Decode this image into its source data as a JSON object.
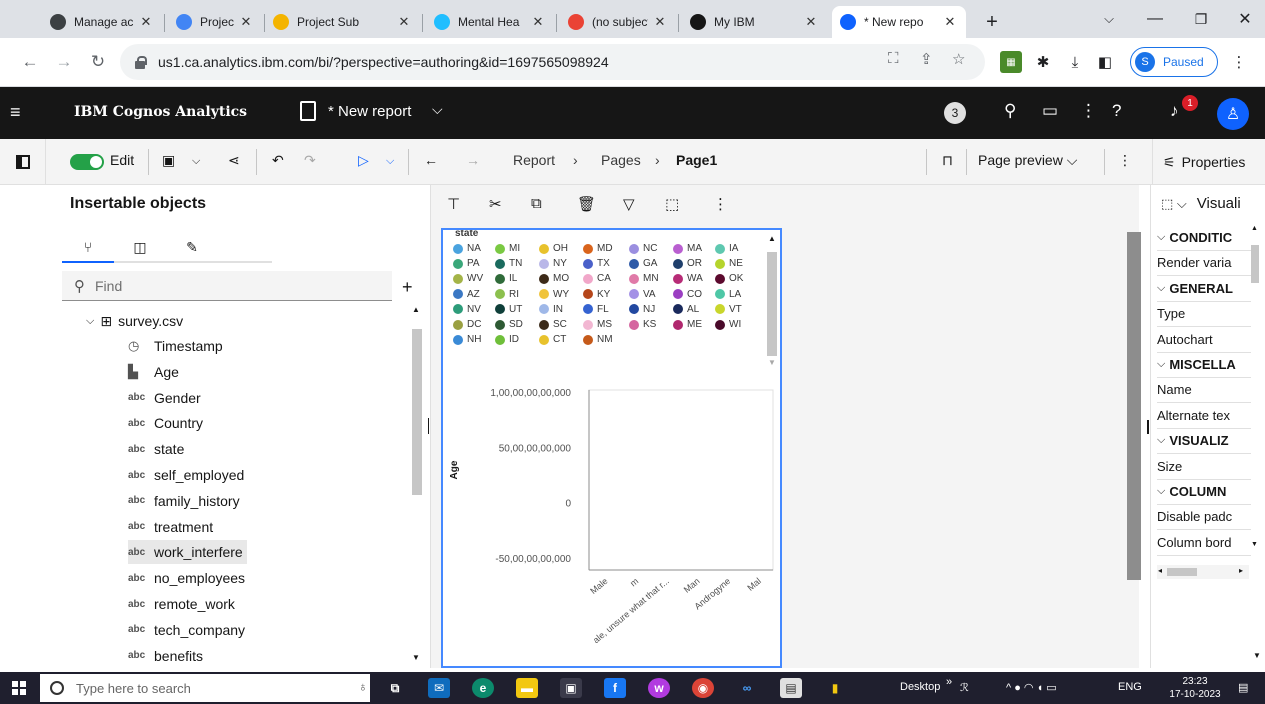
{
  "browser": {
    "tabs": [
      {
        "title": "Manage ac",
        "color": "#3c4043"
      },
      {
        "title": "Project Sub",
        "color": "#4285f4"
      },
      {
        "title": "Project Sub",
        "color": "#f4b400"
      },
      {
        "title": "Mental Hea",
        "color": "#20beff"
      },
      {
        "title": "(no subject",
        "color": "#ea4335"
      },
      {
        "title": "My IBM",
        "color": "#161616"
      },
      {
        "title": "* New repo",
        "color": "#0f62fe"
      }
    ],
    "close_glyph": "✕",
    "url": "us1.ca.analytics.ibm.com/bi/?perspective=authoring&id=1697565098924",
    "profile_initial": "S",
    "profile_status": "Paused"
  },
  "app": {
    "brand": "IBM Cognos Analytics",
    "report_title": "* New report",
    "notification_count": "3",
    "alert_count": "1"
  },
  "toolbar": {
    "edit_label": "Edit",
    "breadcrumbs": [
      "Report",
      "Pages",
      "Page1"
    ],
    "page_preview": "Page preview",
    "properties": "Properties"
  },
  "left_panel": {
    "title": "Insertable objects",
    "find_placeholder": "Find",
    "source": "survey.csv",
    "fields": [
      {
        "type": "◷",
        "name": "Timestamp"
      },
      {
        "type": "▙",
        "name": "Age"
      },
      {
        "type": "abc",
        "name": "Gender"
      },
      {
        "type": "abc",
        "name": "Country"
      },
      {
        "type": "abc",
        "name": "state"
      },
      {
        "type": "abc",
        "name": "self_employed"
      },
      {
        "type": "abc",
        "name": "family_history"
      },
      {
        "type": "abc",
        "name": "treatment"
      },
      {
        "type": "abc",
        "name": "work_interfere"
      },
      {
        "type": "abc",
        "name": "no_employees"
      },
      {
        "type": "abc",
        "name": "remote_work"
      },
      {
        "type": "abc",
        "name": "tech_company"
      },
      {
        "type": "abc",
        "name": "benefits"
      }
    ]
  },
  "chart_data": {
    "type": "bar",
    "legend_title": "state",
    "legend": [
      {
        "name": "NA",
        "color": "#4aa3df"
      },
      {
        "name": "MI",
        "color": "#7ac943"
      },
      {
        "name": "OH",
        "color": "#e8c22c"
      },
      {
        "name": "MD",
        "color": "#d9641c"
      },
      {
        "name": "NC",
        "color": "#9b8fe0"
      },
      {
        "name": "MA",
        "color": "#b95fd0"
      },
      {
        "name": "IA",
        "color": "#5ec8b0"
      },
      {
        "name": "PA",
        "color": "#3aa77a"
      },
      {
        "name": "TN",
        "color": "#1a6b5e"
      },
      {
        "name": "NY",
        "color": "#b9b7e8"
      },
      {
        "name": "TX",
        "color": "#4a60c9"
      },
      {
        "name": "GA",
        "color": "#2e5aa8"
      },
      {
        "name": "OR",
        "color": "#1f3f6b"
      },
      {
        "name": "NE",
        "color": "#b5d42c"
      },
      {
        "name": "WV",
        "color": "#a4b448"
      },
      {
        "name": "IL",
        "color": "#2f6b3a"
      },
      {
        "name": "MO",
        "color": "#3d2a18"
      },
      {
        "name": "CA",
        "color": "#f1a7c9"
      },
      {
        "name": "MN",
        "color": "#e07aa8"
      },
      {
        "name": "WA",
        "color": "#b72c77"
      },
      {
        "name": "OK",
        "color": "#5c0a2e"
      },
      {
        "name": "AZ",
        "color": "#3b78c4"
      },
      {
        "name": "RI",
        "color": "#8cc04e"
      },
      {
        "name": "WY",
        "color": "#f0c43c"
      },
      {
        "name": "KY",
        "color": "#b5461a"
      },
      {
        "name": "VA",
        "color": "#a491e6"
      },
      {
        "name": "CO",
        "color": "#9b3fc2"
      },
      {
        "name": "LA",
        "color": "#4ec7a6"
      },
      {
        "name": "NV",
        "color": "#2d9c7a"
      },
      {
        "name": "UT",
        "color": "#0f3f3a"
      },
      {
        "name": "IN",
        "color": "#9fb8e8"
      },
      {
        "name": "FL",
        "color": "#3563d1"
      },
      {
        "name": "NJ",
        "color": "#2248a0"
      },
      {
        "name": "AL",
        "color": "#1a2a5c"
      },
      {
        "name": "VT",
        "color": "#c9d62c"
      },
      {
        "name": "DC",
        "color": "#9aa042"
      },
      {
        "name": "SD",
        "color": "#2e5a34"
      },
      {
        "name": "SC",
        "color": "#3b2a1a"
      },
      {
        "name": "MS",
        "color": "#f2b7d2"
      },
      {
        "name": "KS",
        "color": "#d566a0"
      },
      {
        "name": "ME",
        "color": "#b0286e"
      },
      {
        "name": "WI",
        "color": "#4a0a2a"
      },
      {
        "name": "NH",
        "color": "#3a8ad6"
      },
      {
        "name": "ID",
        "color": "#6fbf3a"
      },
      {
        "name": "CT",
        "color": "#e8c22c"
      },
      {
        "name": "NM",
        "color": "#c55a1a"
      }
    ],
    "ylabel": "Age",
    "y_ticks": [
      "1,00,00,00,00,000",
      "50,00,00,00,000",
      "0",
      "-50,00,00,00,000"
    ],
    "ylim": [
      -5000000000,
      10000000000
    ],
    "categories": [
      "Male",
      "m",
      "ale, unsure what that r...",
      "Man",
      "Androgyne",
      "Mal"
    ]
  },
  "viz_toolbar_more": "⋮",
  "properties": {
    "heading": "Visuali",
    "rows": [
      {
        "label": "CONDITIC",
        "header": true
      },
      {
        "label": "Render varia",
        "header": false
      },
      {
        "label": "GENERAL",
        "header": true
      },
      {
        "label": "Type",
        "header": false
      },
      {
        "label": "Autochart",
        "header": false
      },
      {
        "label": "MISCELLA",
        "header": true
      },
      {
        "label": "Name",
        "header": false
      },
      {
        "label": "Alternate tex",
        "header": false
      },
      {
        "label": "VISUALIZ",
        "header": true
      },
      {
        "label": "Size",
        "header": false
      },
      {
        "label": "COLUMN",
        "header": true
      },
      {
        "label": "Disable padc",
        "header": false
      },
      {
        "label": "Column bord",
        "header": false
      }
    ]
  },
  "taskbar": {
    "search_placeholder": "Type here to search",
    "desktop": "Desktop",
    "language": "ENG",
    "time": "23:23",
    "date": "17-10-2023"
  }
}
